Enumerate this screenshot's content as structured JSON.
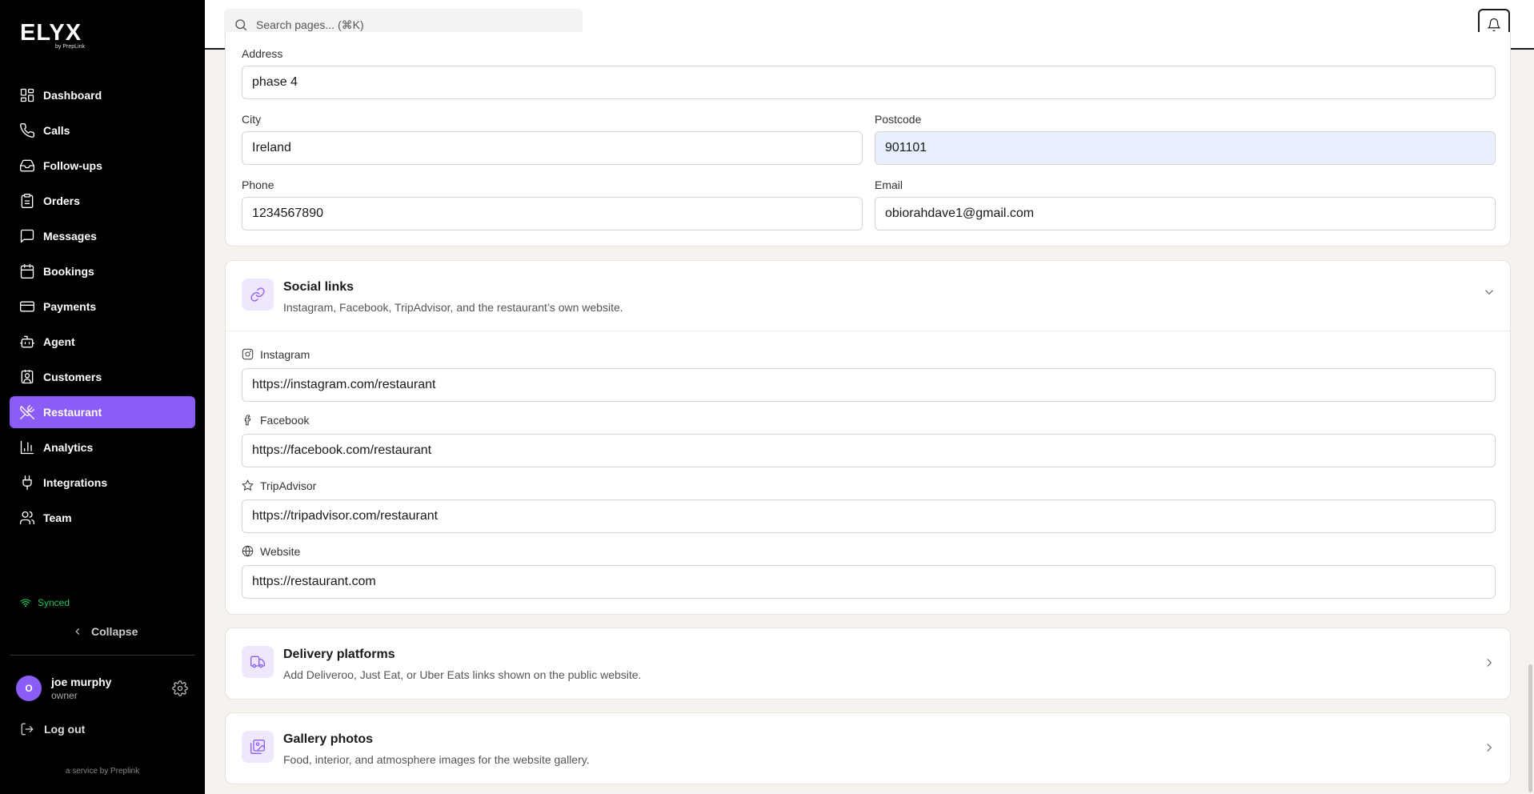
{
  "brand": {
    "name": "ELYX",
    "sub": "by PrepLink"
  },
  "search": {
    "placeholder": "Search pages... (⌘K)"
  },
  "nav": [
    {
      "label": "Dashboard",
      "icon": "dashboard-icon"
    },
    {
      "label": "Calls",
      "icon": "phone-icon"
    },
    {
      "label": "Follow-ups",
      "icon": "inbox-icon"
    },
    {
      "label": "Orders",
      "icon": "clipboard-icon"
    },
    {
      "label": "Messages",
      "icon": "message-icon"
    },
    {
      "label": "Bookings",
      "icon": "calendar-icon"
    },
    {
      "label": "Payments",
      "icon": "credit-card-icon"
    },
    {
      "label": "Agent",
      "icon": "bot-icon"
    },
    {
      "label": "Customers",
      "icon": "contact-icon"
    },
    {
      "label": "Restaurant",
      "icon": "utensils-icon",
      "active": true
    },
    {
      "label": "Analytics",
      "icon": "chart-icon"
    },
    {
      "label": "Integrations",
      "icon": "plug-icon"
    },
    {
      "label": "Team",
      "icon": "users-icon"
    }
  ],
  "status": {
    "synced": "Synced"
  },
  "collapse_label": "Collapse",
  "user": {
    "initial": "O",
    "name": "joe murphy",
    "role": "owner"
  },
  "logout_label": "Log out",
  "footer": "a service by Preplink",
  "contact": {
    "address_label": "Address",
    "address_value": "phase 4",
    "city_label": "City",
    "city_value": "Ireland",
    "postcode_label": "Postcode",
    "postcode_value": "901101",
    "phone_label": "Phone",
    "phone_value": "1234567890",
    "email_label": "Email",
    "email_value": "obiorahdave1@gmail.com"
  },
  "social": {
    "title": "Social links",
    "desc": "Instagram, Facebook, TripAdvisor, and the restaurant’s own website.",
    "instagram_label": "Instagram",
    "instagram_value": "https://instagram.com/restaurant",
    "facebook_label": "Facebook",
    "facebook_value": "https://facebook.com/restaurant",
    "tripadvisor_label": "TripAdvisor",
    "tripadvisor_value": "https://tripadvisor.com/restaurant",
    "website_label": "Website",
    "website_value": "https://restaurant.com"
  },
  "delivery": {
    "title": "Delivery platforms",
    "desc": "Add Deliveroo, Just Eat, or Uber Eats links shown on the public website."
  },
  "gallery": {
    "title": "Gallery photos",
    "desc": "Food, interior, and atmosphere images for the website gallery."
  },
  "colors": {
    "accent": "#8b5cf6",
    "sidebar_bg": "#000000",
    "synced": "#22c55e",
    "page_bg": "#f6f2ee"
  }
}
